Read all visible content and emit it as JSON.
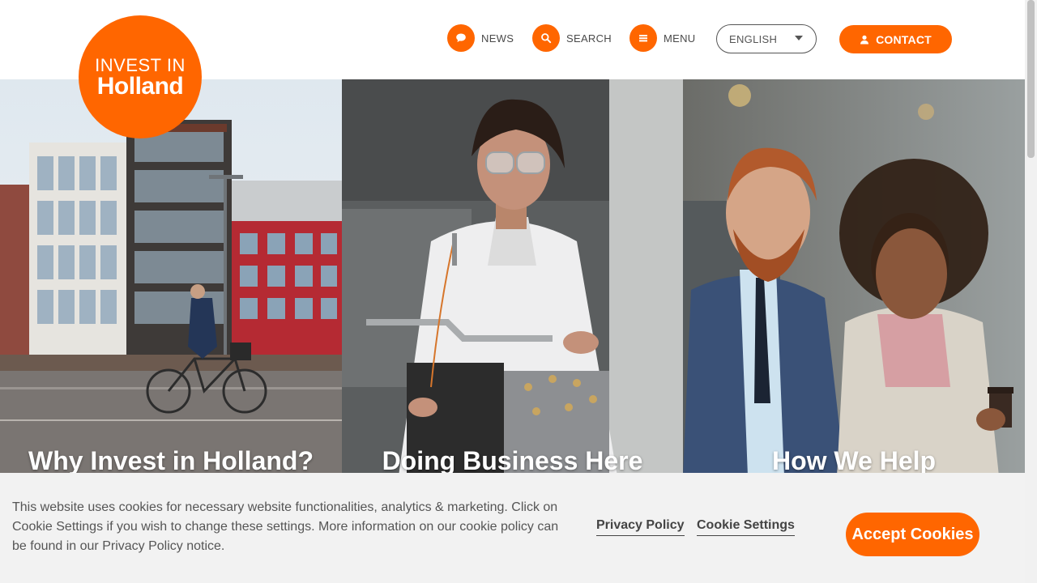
{
  "logo": {
    "line1": "INVEST IN",
    "line2": "Holland"
  },
  "nav": {
    "news": {
      "label": "NEWS",
      "icon": "chat-bubble-icon"
    },
    "search": {
      "label": "SEARCH",
      "icon": "search-icon"
    },
    "menu": {
      "label": "MENU",
      "icon": "hamburger-icon"
    }
  },
  "language": {
    "selected": "ENGLISH"
  },
  "contact": {
    "label": "CONTACT",
    "icon": "user-icon"
  },
  "tiles": [
    {
      "title": "Why Invest in Holland?"
    },
    {
      "title": "Doing Business Here"
    },
    {
      "title": "How We Help"
    }
  ],
  "cookie_banner": {
    "text": "This website uses cookies for necessary website functionalities, analytics & marketing. Click on Cookie Settings if you wish to change these settings. More information on our cookie policy can be found in our Privacy Policy notice.",
    "privacy_label": "Privacy Policy",
    "settings_label": "Cookie Settings",
    "accept_label": "Accept Cookies"
  },
  "colors": {
    "brand": "#ff6600",
    "banner_bg": "#f2f2f2"
  }
}
